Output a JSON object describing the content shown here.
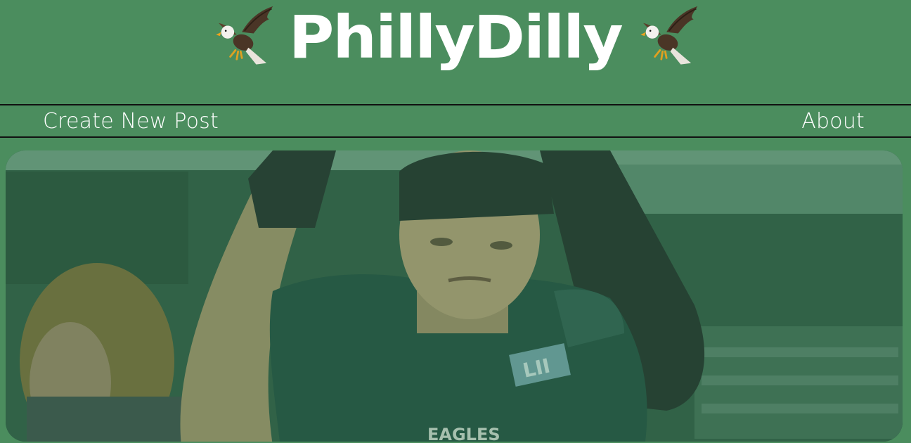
{
  "header": {
    "title": "PhillyDilly",
    "left_icon": "eagle-icon",
    "right_icon": "eagle-icon"
  },
  "nav": {
    "create_label": "Create New Post",
    "about_label": "About"
  },
  "hero": {
    "image": "eagles-player-celebrating-photo",
    "jersey_text": "EAGLES",
    "patch_text": "LII"
  },
  "colors": {
    "background": "#4b8d5e",
    "text": "#ffffff",
    "divider": "#111111"
  }
}
